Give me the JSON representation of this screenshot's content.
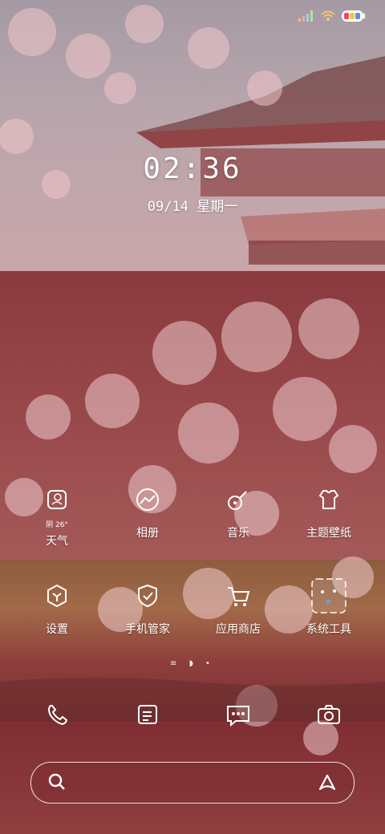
{
  "status": {
    "signal_icon": "signal-icon",
    "wifi_icon": "wifi-icon",
    "battery_icon": "battery-icon"
  },
  "lock": {
    "time": "02:36",
    "date": "09/14 星期一"
  },
  "apps_row1": [
    {
      "label": "天气",
      "icon": "weather-icon",
      "sub": "阴 26°"
    },
    {
      "label": "相册",
      "icon": "gallery-icon"
    },
    {
      "label": "音乐",
      "icon": "guitar-icon"
    },
    {
      "label": "主题壁纸",
      "icon": "tshirt-icon"
    }
  ],
  "apps_row2": [
    {
      "label": "设置",
      "icon": "settings-icon"
    },
    {
      "label": "手机管家",
      "icon": "shield-icon"
    },
    {
      "label": "应用商店",
      "icon": "cart-icon"
    },
    {
      "label": "系统工具",
      "icon": "folder-icon"
    }
  ],
  "dock": [
    {
      "icon": "phone-icon"
    },
    {
      "icon": "notes-icon"
    },
    {
      "icon": "message-icon"
    },
    {
      "icon": "camera-icon"
    }
  ],
  "pager": {
    "text": "≡ ◗ •"
  },
  "colors": {
    "accent": "#8a3a3e",
    "text": "#ffffff"
  }
}
